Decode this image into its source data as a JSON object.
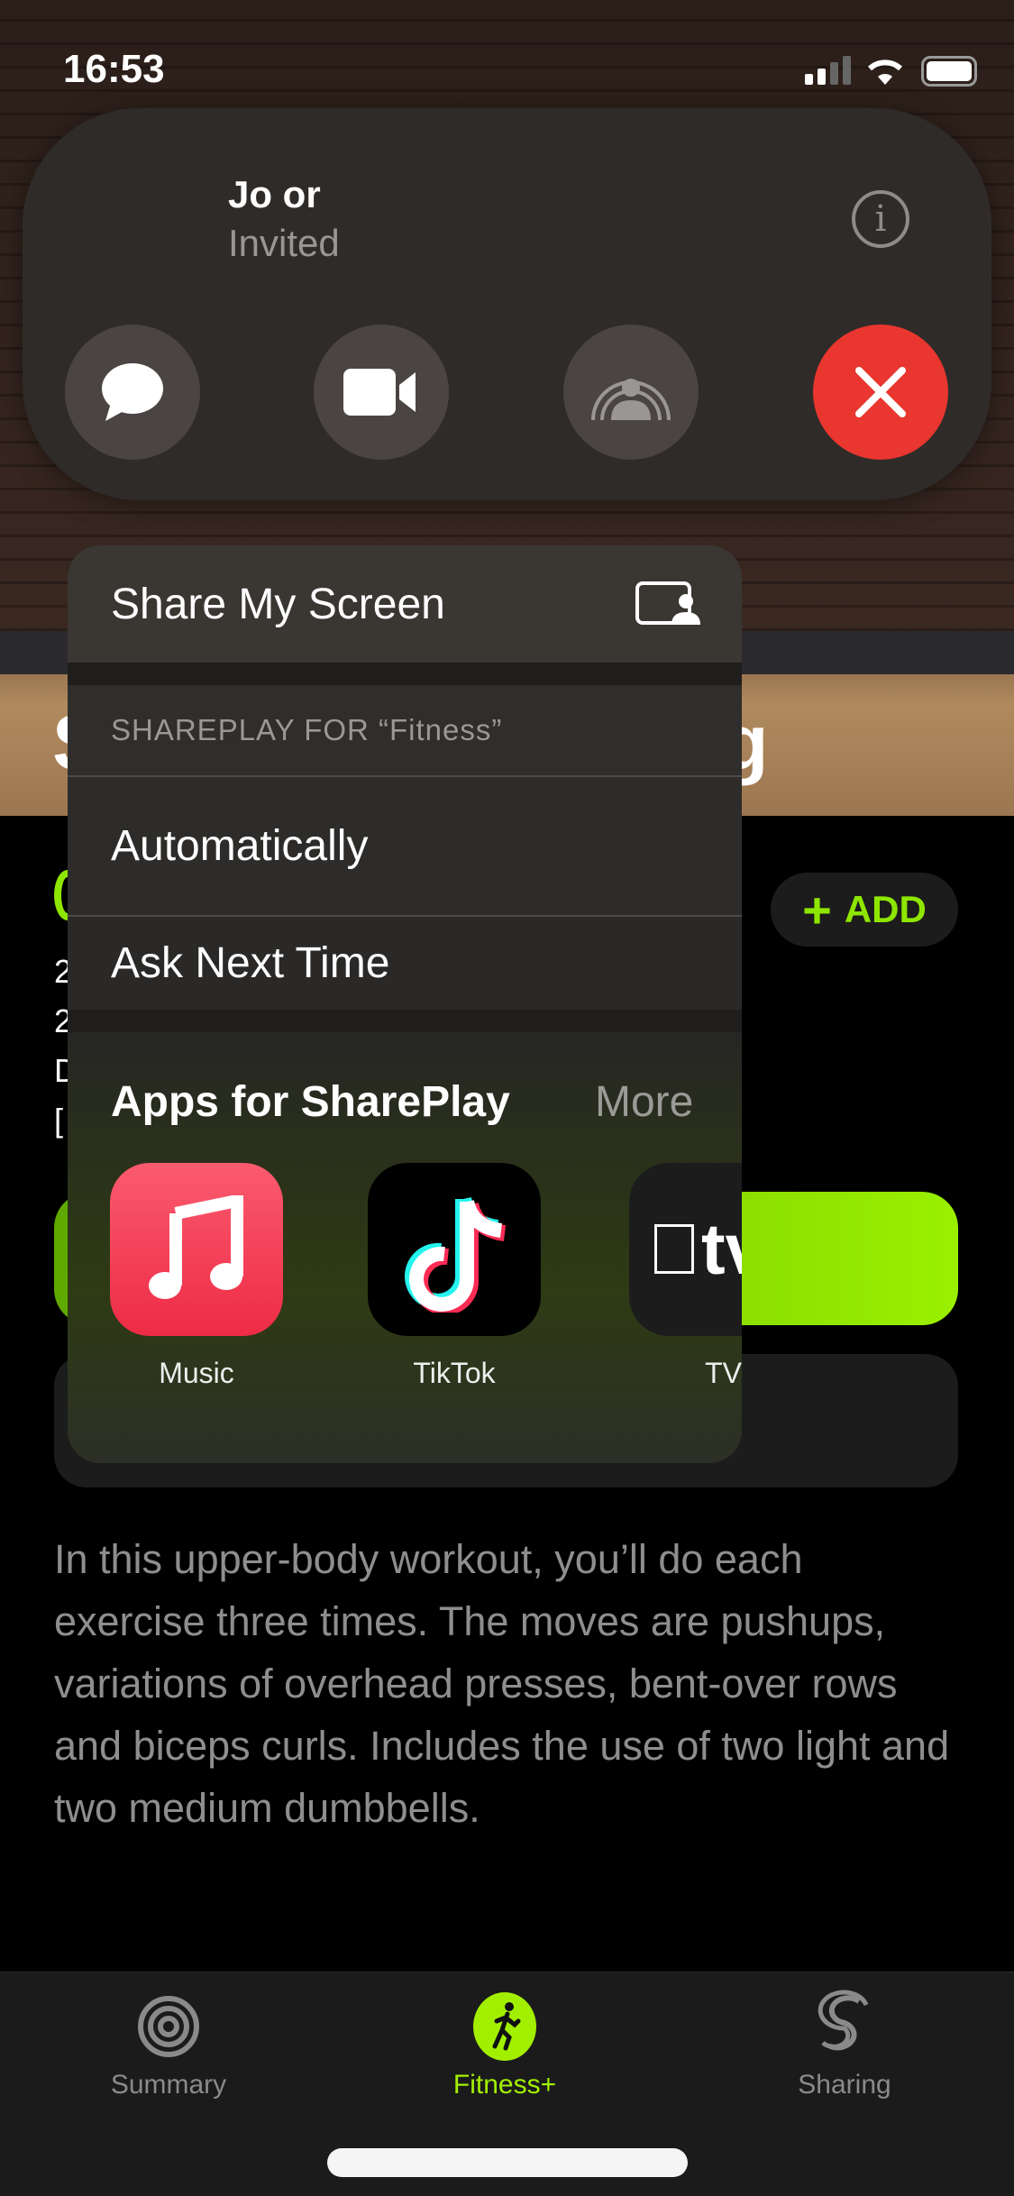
{
  "status_bar": {
    "time": "16:53"
  },
  "call": {
    "name": "Jo or",
    "status": "Invited",
    "buttons": [
      "message-icon",
      "video-icon",
      "shareplay-icon",
      "end-call-icon"
    ],
    "end_color": "#e9362f"
  },
  "background": {
    "title_fragment_left": "S",
    "title_fragment_right": "g",
    "add_label": "ADD",
    "accent": "#8ee600",
    "description": "In this upper-body workout, you’ll do each exercise three times. The moves are pushups, variations of overhead presses, bent-over rows and biceps curls. Includes the use of two light and two medium dumbbells.",
    "meta_fragments": [
      "2",
      "2",
      "D",
      "["
    ]
  },
  "menu": {
    "share_screen": "Share My Screen",
    "shareplay_header": "SHAREPLAY FOR “Fitness”",
    "options": [
      "Automatically",
      "Ask Next Time"
    ],
    "apps_title": "Apps for SharePlay",
    "more": "More",
    "apps": [
      {
        "label": "Music"
      },
      {
        "label": "TikTok"
      },
      {
        "label": "TV"
      }
    ]
  },
  "tabbar": {
    "tabs": [
      {
        "label": "Summary",
        "icon": "activity-rings-icon"
      },
      {
        "label": "Fitness+",
        "icon": "running-figure-icon",
        "active": true
      },
      {
        "label": "Sharing",
        "icon": "sharing-icon"
      }
    ]
  }
}
